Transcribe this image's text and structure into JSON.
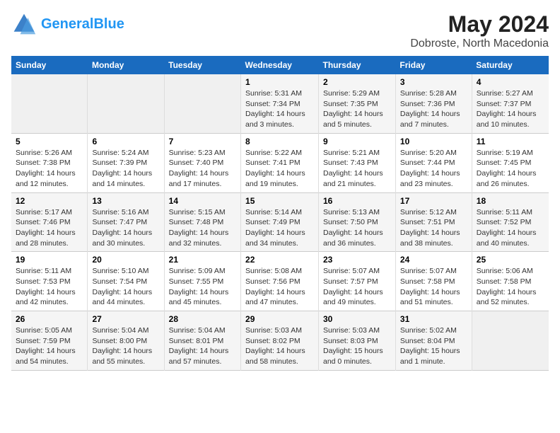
{
  "header": {
    "logo_line1": "General",
    "logo_line2": "Blue",
    "title": "May 2024",
    "subtitle": "Dobroste, North Macedonia"
  },
  "weekdays": [
    "Sunday",
    "Monday",
    "Tuesday",
    "Wednesday",
    "Thursday",
    "Friday",
    "Saturday"
  ],
  "weeks": [
    [
      {
        "day": "",
        "info": ""
      },
      {
        "day": "",
        "info": ""
      },
      {
        "day": "",
        "info": ""
      },
      {
        "day": "1",
        "info": "Sunrise: 5:31 AM\nSunset: 7:34 PM\nDaylight: 14 hours and 3 minutes."
      },
      {
        "day": "2",
        "info": "Sunrise: 5:29 AM\nSunset: 7:35 PM\nDaylight: 14 hours and 5 minutes."
      },
      {
        "day": "3",
        "info": "Sunrise: 5:28 AM\nSunset: 7:36 PM\nDaylight: 14 hours and 7 minutes."
      },
      {
        "day": "4",
        "info": "Sunrise: 5:27 AM\nSunset: 7:37 PM\nDaylight: 14 hours and 10 minutes."
      }
    ],
    [
      {
        "day": "5",
        "info": "Sunrise: 5:26 AM\nSunset: 7:38 PM\nDaylight: 14 hours and 12 minutes."
      },
      {
        "day": "6",
        "info": "Sunrise: 5:24 AM\nSunset: 7:39 PM\nDaylight: 14 hours and 14 minutes."
      },
      {
        "day": "7",
        "info": "Sunrise: 5:23 AM\nSunset: 7:40 PM\nDaylight: 14 hours and 17 minutes."
      },
      {
        "day": "8",
        "info": "Sunrise: 5:22 AM\nSunset: 7:41 PM\nDaylight: 14 hours and 19 minutes."
      },
      {
        "day": "9",
        "info": "Sunrise: 5:21 AM\nSunset: 7:43 PM\nDaylight: 14 hours and 21 minutes."
      },
      {
        "day": "10",
        "info": "Sunrise: 5:20 AM\nSunset: 7:44 PM\nDaylight: 14 hours and 23 minutes."
      },
      {
        "day": "11",
        "info": "Sunrise: 5:19 AM\nSunset: 7:45 PM\nDaylight: 14 hours and 26 minutes."
      }
    ],
    [
      {
        "day": "12",
        "info": "Sunrise: 5:17 AM\nSunset: 7:46 PM\nDaylight: 14 hours and 28 minutes."
      },
      {
        "day": "13",
        "info": "Sunrise: 5:16 AM\nSunset: 7:47 PM\nDaylight: 14 hours and 30 minutes."
      },
      {
        "day": "14",
        "info": "Sunrise: 5:15 AM\nSunset: 7:48 PM\nDaylight: 14 hours and 32 minutes."
      },
      {
        "day": "15",
        "info": "Sunrise: 5:14 AM\nSunset: 7:49 PM\nDaylight: 14 hours and 34 minutes."
      },
      {
        "day": "16",
        "info": "Sunrise: 5:13 AM\nSunset: 7:50 PM\nDaylight: 14 hours and 36 minutes."
      },
      {
        "day": "17",
        "info": "Sunrise: 5:12 AM\nSunset: 7:51 PM\nDaylight: 14 hours and 38 minutes."
      },
      {
        "day": "18",
        "info": "Sunrise: 5:11 AM\nSunset: 7:52 PM\nDaylight: 14 hours and 40 minutes."
      }
    ],
    [
      {
        "day": "19",
        "info": "Sunrise: 5:11 AM\nSunset: 7:53 PM\nDaylight: 14 hours and 42 minutes."
      },
      {
        "day": "20",
        "info": "Sunrise: 5:10 AM\nSunset: 7:54 PM\nDaylight: 14 hours and 44 minutes."
      },
      {
        "day": "21",
        "info": "Sunrise: 5:09 AM\nSunset: 7:55 PM\nDaylight: 14 hours and 45 minutes."
      },
      {
        "day": "22",
        "info": "Sunrise: 5:08 AM\nSunset: 7:56 PM\nDaylight: 14 hours and 47 minutes."
      },
      {
        "day": "23",
        "info": "Sunrise: 5:07 AM\nSunset: 7:57 PM\nDaylight: 14 hours and 49 minutes."
      },
      {
        "day": "24",
        "info": "Sunrise: 5:07 AM\nSunset: 7:58 PM\nDaylight: 14 hours and 51 minutes."
      },
      {
        "day": "25",
        "info": "Sunrise: 5:06 AM\nSunset: 7:58 PM\nDaylight: 14 hours and 52 minutes."
      }
    ],
    [
      {
        "day": "26",
        "info": "Sunrise: 5:05 AM\nSunset: 7:59 PM\nDaylight: 14 hours and 54 minutes."
      },
      {
        "day": "27",
        "info": "Sunrise: 5:04 AM\nSunset: 8:00 PM\nDaylight: 14 hours and 55 minutes."
      },
      {
        "day": "28",
        "info": "Sunrise: 5:04 AM\nSunset: 8:01 PM\nDaylight: 14 hours and 57 minutes."
      },
      {
        "day": "29",
        "info": "Sunrise: 5:03 AM\nSunset: 8:02 PM\nDaylight: 14 hours and 58 minutes."
      },
      {
        "day": "30",
        "info": "Sunrise: 5:03 AM\nSunset: 8:03 PM\nDaylight: 15 hours and 0 minutes."
      },
      {
        "day": "31",
        "info": "Sunrise: 5:02 AM\nSunset: 8:04 PM\nDaylight: 15 hours and 1 minute."
      },
      {
        "day": "",
        "info": ""
      }
    ]
  ]
}
